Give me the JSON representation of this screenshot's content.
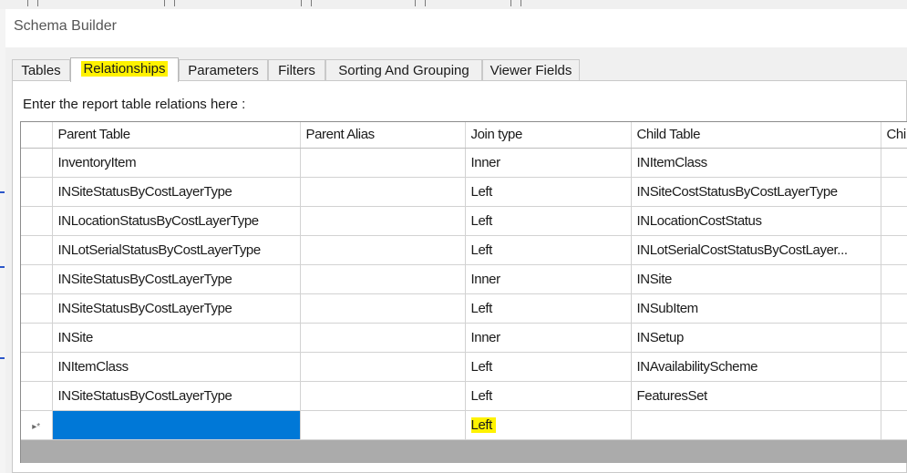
{
  "window": {
    "title": "Schema Builder"
  },
  "tabs": [
    {
      "label": "Tables",
      "active": false
    },
    {
      "label": "Relationships",
      "active": true,
      "highlighted": true
    },
    {
      "label": "Parameters",
      "active": false
    },
    {
      "label": "Filters",
      "active": false
    },
    {
      "label": "Sorting And Grouping",
      "active": false
    },
    {
      "label": "Viewer Fields",
      "active": false
    }
  ],
  "instruction": "Enter the report table relations here :",
  "grid": {
    "columns": [
      "Parent Table",
      "Parent Alias",
      "Join type",
      "Child Table",
      "Chi"
    ],
    "rows": [
      {
        "parent_table": "InventoryItem",
        "parent_alias": "",
        "join_type": "Inner",
        "child_table": "INItemClass"
      },
      {
        "parent_table": "INSiteStatusByCostLayerType",
        "parent_alias": "",
        "join_type": "Left",
        "child_table": "INSiteCostStatusByCostLayerType"
      },
      {
        "parent_table": "INLocationStatusByCostLayerType",
        "parent_alias": "",
        "join_type": "Left",
        "child_table": "INLocationCostStatus"
      },
      {
        "parent_table": "INLotSerialStatusByCostLayerType",
        "parent_alias": "",
        "join_type": "Left",
        "child_table": "INLotSerialCostStatusByCostLayer..."
      },
      {
        "parent_table": "INSiteStatusByCostLayerType",
        "parent_alias": "",
        "join_type": "Inner",
        "child_table": "INSite"
      },
      {
        "parent_table": "INSiteStatusByCostLayerType",
        "parent_alias": "",
        "join_type": "Left",
        "child_table": "INSubItem"
      },
      {
        "parent_table": "INSite",
        "parent_alias": "",
        "join_type": "Inner",
        "child_table": "INSetup"
      },
      {
        "parent_table": "INItemClass",
        "parent_alias": "",
        "join_type": "Left",
        "child_table": "INAvailabilityScheme"
      },
      {
        "parent_table": "INSiteStatusByCostLayerType",
        "parent_alias": "",
        "join_type": "Left",
        "child_table": "FeaturesSet"
      }
    ],
    "new_row": {
      "marker": "▸*",
      "parent_table": "",
      "parent_alias": "",
      "join_type": "Left",
      "child_table": ""
    }
  },
  "colors": {
    "selection": "#0078d7",
    "highlight": "#fff200",
    "tab_bar": "#f0f0f0"
  }
}
